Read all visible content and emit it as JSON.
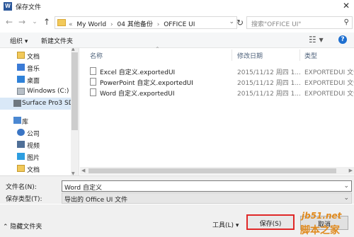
{
  "window": {
    "title": "保存文件",
    "app_icon_letter": "W",
    "close_glyph": "✕"
  },
  "nav": {
    "back": "←",
    "forward": "→",
    "dropdown": "⌄",
    "up": "↑",
    "breadcrumb": [
      "«",
      "My World",
      "›",
      "04 其他备份",
      "›",
      "OFFICE UI"
    ],
    "search_placeholder": "搜索\"OFFICE UI\""
  },
  "toolbar": {
    "organize": "组织 ▾",
    "new_folder": "新建文件夹",
    "view_glyph": "☷ ▾",
    "help": "?"
  },
  "sidebar": {
    "items": [
      {
        "label": "文档",
        "icon": "documents-icon"
      },
      {
        "label": "音乐",
        "icon": "music-icon"
      },
      {
        "label": "桌面",
        "icon": "desktop-icon"
      },
      {
        "label": "Windows (C:)",
        "icon": "drive-icon"
      },
      {
        "label": "Surface Pro3 SD",
        "icon": "sd-card-icon"
      },
      {
        "label": "库",
        "icon": "library-icon"
      },
      {
        "label": "公司",
        "icon": "user-icon"
      },
      {
        "label": "视频",
        "icon": "video-icon"
      },
      {
        "label": "图片",
        "icon": "pictures-icon"
      },
      {
        "label": "文档",
        "icon": "documents-icon"
      }
    ]
  },
  "columns": {
    "name": "名称",
    "date": "修改日期",
    "type": "类型"
  },
  "files": [
    {
      "name": "Excel 自定义.exportedUI",
      "date": "2015/11/12 周四 1...",
      "type": "EXPORTEDUI 文件"
    },
    {
      "name": "PowerPoint 自定义.exportedUI",
      "date": "2015/11/12 周四 1...",
      "type": "EXPORTEDUI 文件"
    },
    {
      "name": "Word 自定义.exportedUI",
      "date": "2015/11/12 周四 1...",
      "type": "EXPORTEDUI 文件"
    }
  ],
  "form": {
    "filename_label": "文件名(N):",
    "filename_value": "Word 自定义",
    "filetype_label": "保存类型(T):",
    "filetype_value": "导出的 Office UI 文件"
  },
  "footer": {
    "hide_folders": "隐藏文件夹",
    "tools": "工具(L) ▾",
    "save": "保存(S)",
    "cancel": "取消"
  },
  "watermark": {
    "top": "jb51.net",
    "bottom": "脚本之家"
  }
}
